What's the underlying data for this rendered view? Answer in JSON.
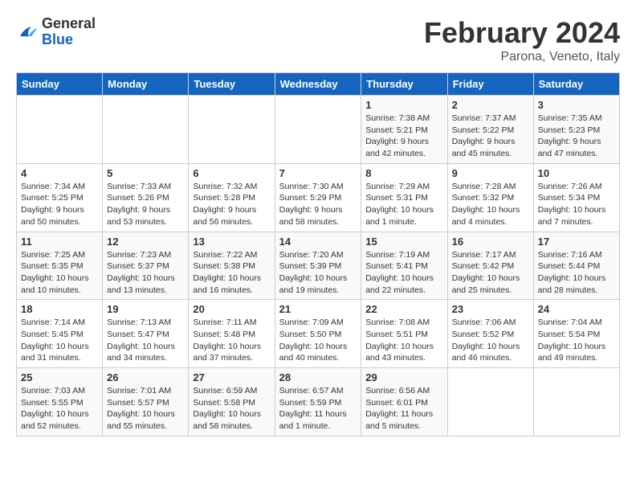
{
  "header": {
    "logo_general": "General",
    "logo_blue": "Blue",
    "month_title": "February 2024",
    "subtitle": "Parona, Veneto, Italy"
  },
  "columns": [
    "Sunday",
    "Monday",
    "Tuesday",
    "Wednesday",
    "Thursday",
    "Friday",
    "Saturday"
  ],
  "weeks": [
    [
      {
        "day": "",
        "info": ""
      },
      {
        "day": "",
        "info": ""
      },
      {
        "day": "",
        "info": ""
      },
      {
        "day": "",
        "info": ""
      },
      {
        "day": "1",
        "info": "Sunrise: 7:38 AM\nSunset: 5:21 PM\nDaylight: 9 hours\nand 42 minutes."
      },
      {
        "day": "2",
        "info": "Sunrise: 7:37 AM\nSunset: 5:22 PM\nDaylight: 9 hours\nand 45 minutes."
      },
      {
        "day": "3",
        "info": "Sunrise: 7:35 AM\nSunset: 5:23 PM\nDaylight: 9 hours\nand 47 minutes."
      }
    ],
    [
      {
        "day": "4",
        "info": "Sunrise: 7:34 AM\nSunset: 5:25 PM\nDaylight: 9 hours\nand 50 minutes."
      },
      {
        "day": "5",
        "info": "Sunrise: 7:33 AM\nSunset: 5:26 PM\nDaylight: 9 hours\nand 53 minutes."
      },
      {
        "day": "6",
        "info": "Sunrise: 7:32 AM\nSunset: 5:28 PM\nDaylight: 9 hours\nand 56 minutes."
      },
      {
        "day": "7",
        "info": "Sunrise: 7:30 AM\nSunset: 5:29 PM\nDaylight: 9 hours\nand 58 minutes."
      },
      {
        "day": "8",
        "info": "Sunrise: 7:29 AM\nSunset: 5:31 PM\nDaylight: 10 hours\nand 1 minute."
      },
      {
        "day": "9",
        "info": "Sunrise: 7:28 AM\nSunset: 5:32 PM\nDaylight: 10 hours\nand 4 minutes."
      },
      {
        "day": "10",
        "info": "Sunrise: 7:26 AM\nSunset: 5:34 PM\nDaylight: 10 hours\nand 7 minutes."
      }
    ],
    [
      {
        "day": "11",
        "info": "Sunrise: 7:25 AM\nSunset: 5:35 PM\nDaylight: 10 hours\nand 10 minutes."
      },
      {
        "day": "12",
        "info": "Sunrise: 7:23 AM\nSunset: 5:37 PM\nDaylight: 10 hours\nand 13 minutes."
      },
      {
        "day": "13",
        "info": "Sunrise: 7:22 AM\nSunset: 5:38 PM\nDaylight: 10 hours\nand 16 minutes."
      },
      {
        "day": "14",
        "info": "Sunrise: 7:20 AM\nSunset: 5:39 PM\nDaylight: 10 hours\nand 19 minutes."
      },
      {
        "day": "15",
        "info": "Sunrise: 7:19 AM\nSunset: 5:41 PM\nDaylight: 10 hours\nand 22 minutes."
      },
      {
        "day": "16",
        "info": "Sunrise: 7:17 AM\nSunset: 5:42 PM\nDaylight: 10 hours\nand 25 minutes."
      },
      {
        "day": "17",
        "info": "Sunrise: 7:16 AM\nSunset: 5:44 PM\nDaylight: 10 hours\nand 28 minutes."
      }
    ],
    [
      {
        "day": "18",
        "info": "Sunrise: 7:14 AM\nSunset: 5:45 PM\nDaylight: 10 hours\nand 31 minutes."
      },
      {
        "day": "19",
        "info": "Sunrise: 7:13 AM\nSunset: 5:47 PM\nDaylight: 10 hours\nand 34 minutes."
      },
      {
        "day": "20",
        "info": "Sunrise: 7:11 AM\nSunset: 5:48 PM\nDaylight: 10 hours\nand 37 minutes."
      },
      {
        "day": "21",
        "info": "Sunrise: 7:09 AM\nSunset: 5:50 PM\nDaylight: 10 hours\nand 40 minutes."
      },
      {
        "day": "22",
        "info": "Sunrise: 7:08 AM\nSunset: 5:51 PM\nDaylight: 10 hours\nand 43 minutes."
      },
      {
        "day": "23",
        "info": "Sunrise: 7:06 AM\nSunset: 5:52 PM\nDaylight: 10 hours\nand 46 minutes."
      },
      {
        "day": "24",
        "info": "Sunrise: 7:04 AM\nSunset: 5:54 PM\nDaylight: 10 hours\nand 49 minutes."
      }
    ],
    [
      {
        "day": "25",
        "info": "Sunrise: 7:03 AM\nSunset: 5:55 PM\nDaylight: 10 hours\nand 52 minutes."
      },
      {
        "day": "26",
        "info": "Sunrise: 7:01 AM\nSunset: 5:57 PM\nDaylight: 10 hours\nand 55 minutes."
      },
      {
        "day": "27",
        "info": "Sunrise: 6:59 AM\nSunset: 5:58 PM\nDaylight: 10 hours\nand 58 minutes."
      },
      {
        "day": "28",
        "info": "Sunrise: 6:57 AM\nSunset: 5:59 PM\nDaylight: 11 hours\nand 1 minute."
      },
      {
        "day": "29",
        "info": "Sunrise: 6:56 AM\nSunset: 6:01 PM\nDaylight: 11 hours\nand 5 minutes."
      },
      {
        "day": "",
        "info": ""
      },
      {
        "day": "",
        "info": ""
      }
    ]
  ]
}
